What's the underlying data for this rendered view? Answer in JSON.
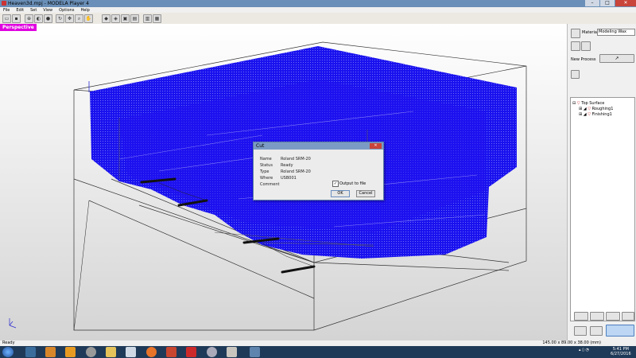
{
  "window": {
    "title": "Heaven3d.mpj - MODELA Player 4",
    "min": "–",
    "max": "□",
    "close": "✕"
  },
  "menu": [
    "File",
    "Edit",
    "Set",
    "View",
    "Options",
    "Help"
  ],
  "viewport": {
    "label": "Perspective"
  },
  "right_panel": {
    "material_label": "Material",
    "material_value": "Modeling Wax",
    "new_process_label": "New Process",
    "tree": {
      "root": "Top Surface",
      "children": [
        "Roughing1",
        "Finishing1"
      ]
    }
  },
  "dialog": {
    "title": "Cut",
    "close": "✕",
    "fields": [
      {
        "label": "Name",
        "value": "Roland SRM-20"
      },
      {
        "label": "Status",
        "value": "Ready"
      },
      {
        "label": "Type",
        "value": "Roland SRM-20"
      },
      {
        "label": "Where",
        "value": "USB001"
      },
      {
        "label": "Comment",
        "value": ""
      }
    ],
    "output_to_file": "Output to file",
    "ok": "OK",
    "cancel": "Cancel"
  },
  "status": {
    "left": "Ready",
    "dims": "145.00 x 89.00 x 38.00 (mm)"
  },
  "taskbar": {
    "time": "5:41 PM",
    "date": "6/27/2016"
  },
  "colors": {
    "toolpath": "#1a12ee",
    "accent": "#e000e0"
  }
}
